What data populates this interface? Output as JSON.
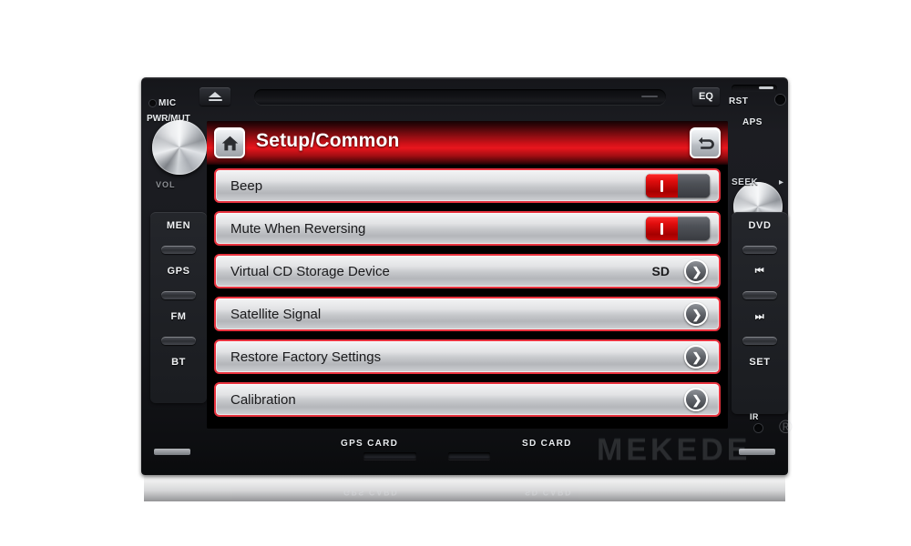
{
  "device": {
    "brand": "MEKEDE",
    "brand_mark": "®",
    "top": {
      "mic_label": "MIC",
      "power_mute_label": "PWR/MUT",
      "eject_label": "eject-icon",
      "eq_label": "EQ",
      "reset_label": "RST",
      "aps_label": "APS"
    },
    "knobs": {
      "volume_label": "VOL",
      "seek_label": "SEEK",
      "left_arrow": "◂",
      "right_arrow": "▸"
    },
    "left_buttons": [
      {
        "label": "MEN"
      },
      {
        "label": "GPS"
      },
      {
        "label": "FM"
      },
      {
        "label": "BT"
      }
    ],
    "right_buttons": [
      {
        "label": "DVD"
      },
      {
        "label": "⏮"
      },
      {
        "label": "⏭"
      },
      {
        "label": "SET"
      }
    ],
    "bottom": {
      "gps_card_label": "GPS CARD",
      "sd_card_label": "SD CARD",
      "ir_label": "IR"
    }
  },
  "screen": {
    "header": {
      "title": "Setup/Common",
      "home_icon": "home-icon",
      "back_icon": "back-arrow-icon",
      "accent_color": "#e8161d"
    },
    "menu": [
      {
        "label": "Beep",
        "control": "toggle",
        "value": "on"
      },
      {
        "label": "Mute When Reversing",
        "control": "toggle",
        "value": "on"
      },
      {
        "label": "Virtual CD Storage Device",
        "control": "chevron",
        "value": "SD"
      },
      {
        "label": "Satellite Signal",
        "control": "chevron",
        "value": ""
      },
      {
        "label": "Restore Factory Settings",
        "control": "chevron",
        "value": ""
      },
      {
        "label": "Calibration",
        "control": "chevron",
        "value": ""
      }
    ],
    "chevron_glyph": "❯",
    "toggle_on_glyph": "I"
  }
}
